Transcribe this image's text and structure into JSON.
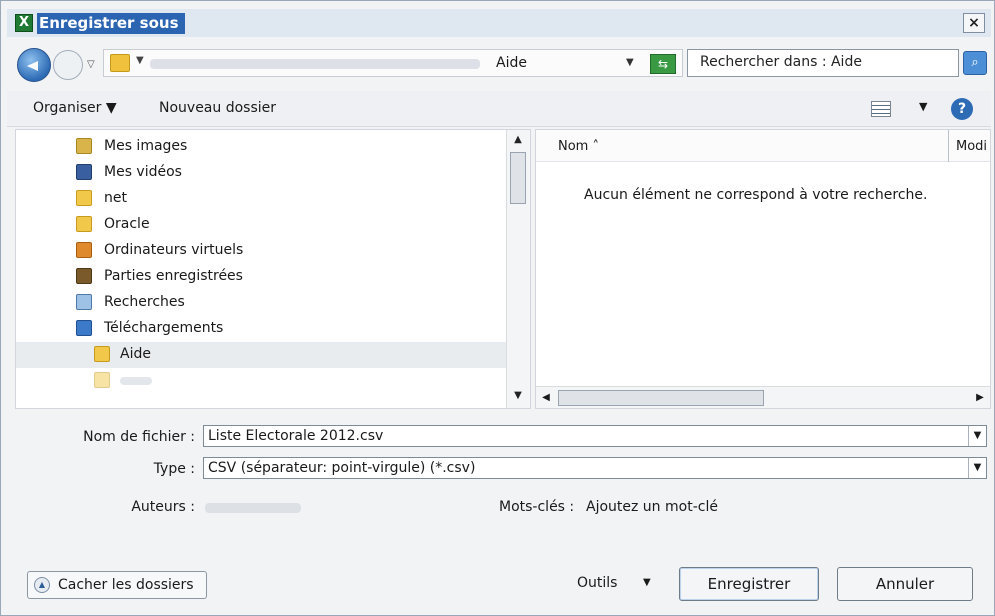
{
  "window": {
    "title": "Enregistrer sous",
    "close": "×"
  },
  "address": {
    "current_folder": "Aide",
    "search_placeholder": "Rechercher dans : Aide"
  },
  "toolbar": {
    "organise": "Organiser",
    "new_folder": "Nouveau dossier"
  },
  "nav_tree": [
    {
      "label": "Mes images",
      "icon": "pictures-icon"
    },
    {
      "label": "Mes vidéos",
      "icon": "videos-icon"
    },
    {
      "label": "net",
      "icon": "folder-icon"
    },
    {
      "label": "Oracle",
      "icon": "folder-icon"
    },
    {
      "label": "Ordinateurs virtuels",
      "icon": "virtual-machines-icon"
    },
    {
      "label": "Parties enregistrées",
      "icon": "saved-games-icon"
    },
    {
      "label": "Recherches",
      "icon": "searches-icon"
    },
    {
      "label": "Téléchargements",
      "icon": "downloads-icon"
    },
    {
      "label": "Aide",
      "icon": "folder-icon",
      "selected": true
    },
    {
      "label": "",
      "icon": "folder-icon"
    }
  ],
  "file_list": {
    "col_name": "Nom",
    "col_modified": "Modi",
    "empty_message": "Aucun élément ne correspond à votre recherche."
  },
  "form": {
    "filename_label": "Nom de fichier :",
    "filename_value": "Liste Electorale 2012.csv",
    "type_label": "Type :",
    "type_value": "CSV (séparateur: point-virgule) (*.csv)",
    "authors_label": "Auteurs :",
    "keywords_label": "Mots-clés :",
    "keywords_value": "Ajoutez un mot-clé"
  },
  "footer": {
    "hide_folders": "Cacher les dossiers",
    "tools": "Outils",
    "save": "Enregistrer",
    "cancel": "Annuler"
  }
}
